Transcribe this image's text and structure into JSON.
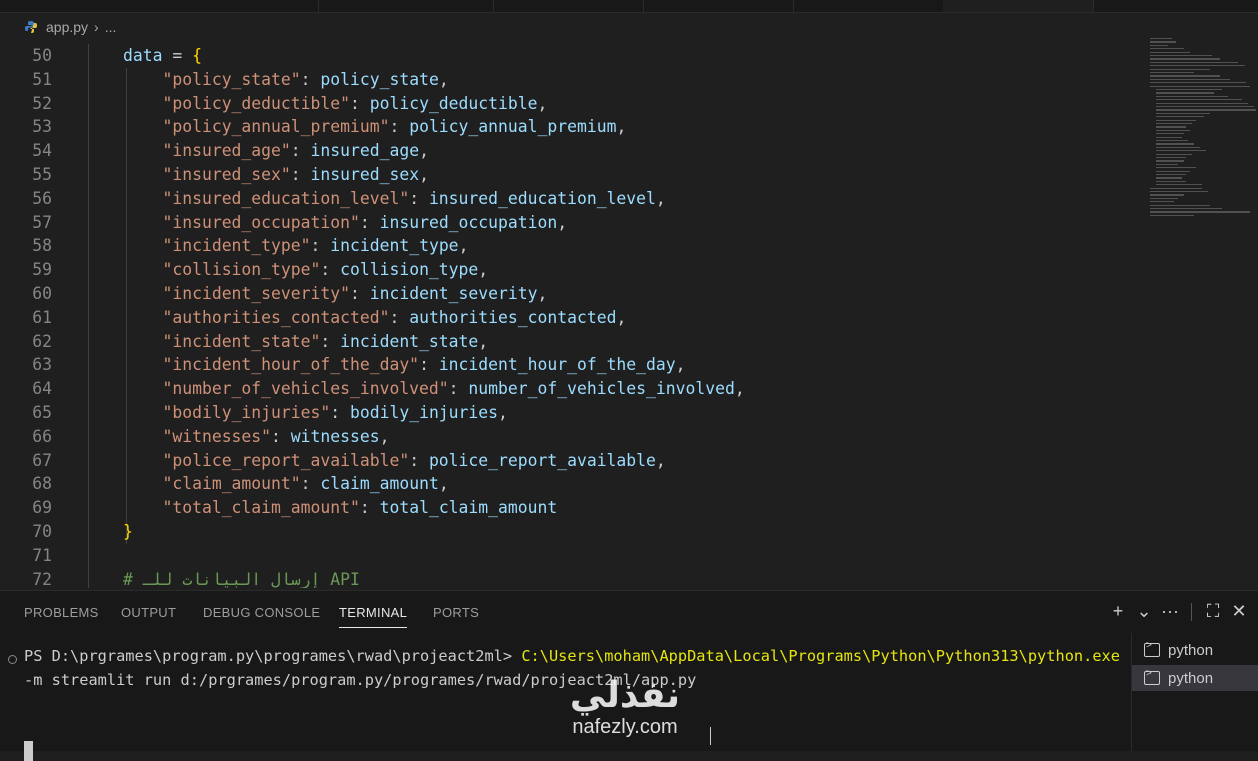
{
  "breadcrumb": {
    "file": "app.py",
    "more": "..."
  },
  "editor": {
    "lines": [
      {
        "num": "50",
        "parts": [
          [
            "v",
            "data"
          ],
          [
            "p",
            " = "
          ],
          [
            "br",
            "{"
          ]
        ]
      },
      {
        "num": "51",
        "parts": [
          [
            "p",
            "    "
          ],
          [
            "k",
            "\"policy_state\""
          ],
          [
            "p",
            ": "
          ],
          [
            "v",
            "policy_state"
          ],
          [
            "p",
            ","
          ]
        ]
      },
      {
        "num": "52",
        "parts": [
          [
            "p",
            "    "
          ],
          [
            "k",
            "\"policy_deductible\""
          ],
          [
            "p",
            ": "
          ],
          [
            "v",
            "policy_deductible"
          ],
          [
            "p",
            ","
          ]
        ]
      },
      {
        "num": "53",
        "parts": [
          [
            "p",
            "    "
          ],
          [
            "k",
            "\"policy_annual_premium\""
          ],
          [
            "p",
            ": "
          ],
          [
            "v",
            "policy_annual_premium"
          ],
          [
            "p",
            ","
          ]
        ]
      },
      {
        "num": "54",
        "parts": [
          [
            "p",
            "    "
          ],
          [
            "k",
            "\"insured_age\""
          ],
          [
            "p",
            ": "
          ],
          [
            "v",
            "insured_age"
          ],
          [
            "p",
            ","
          ]
        ]
      },
      {
        "num": "55",
        "parts": [
          [
            "p",
            "    "
          ],
          [
            "k",
            "\"insured_sex\""
          ],
          [
            "p",
            ": "
          ],
          [
            "v",
            "insured_sex"
          ],
          [
            "p",
            ","
          ]
        ]
      },
      {
        "num": "56",
        "parts": [
          [
            "p",
            "    "
          ],
          [
            "k",
            "\"insured_education_level\""
          ],
          [
            "p",
            ": "
          ],
          [
            "v",
            "insured_education_level"
          ],
          [
            "p",
            ","
          ]
        ]
      },
      {
        "num": "57",
        "parts": [
          [
            "p",
            "    "
          ],
          [
            "k",
            "\"insured_occupation\""
          ],
          [
            "p",
            ": "
          ],
          [
            "v",
            "insured_occupation"
          ],
          [
            "p",
            ","
          ]
        ]
      },
      {
        "num": "58",
        "parts": [
          [
            "p",
            "    "
          ],
          [
            "k",
            "\"incident_type\""
          ],
          [
            "p",
            ": "
          ],
          [
            "v",
            "incident_type"
          ],
          [
            "p",
            ","
          ]
        ]
      },
      {
        "num": "59",
        "parts": [
          [
            "p",
            "    "
          ],
          [
            "k",
            "\"collision_type\""
          ],
          [
            "p",
            ": "
          ],
          [
            "v",
            "collision_type"
          ],
          [
            "p",
            ","
          ]
        ]
      },
      {
        "num": "60",
        "parts": [
          [
            "p",
            "    "
          ],
          [
            "k",
            "\"incident_severity\""
          ],
          [
            "p",
            ": "
          ],
          [
            "v",
            "incident_severity"
          ],
          [
            "p",
            ","
          ]
        ]
      },
      {
        "num": "61",
        "parts": [
          [
            "p",
            "    "
          ],
          [
            "k",
            "\"authorities_contacted\""
          ],
          [
            "p",
            ": "
          ],
          [
            "v",
            "authorities_contacted"
          ],
          [
            "p",
            ","
          ]
        ]
      },
      {
        "num": "62",
        "parts": [
          [
            "p",
            "    "
          ],
          [
            "k",
            "\"incident_state\""
          ],
          [
            "p",
            ": "
          ],
          [
            "v",
            "incident_state"
          ],
          [
            "p",
            ","
          ]
        ]
      },
      {
        "num": "63",
        "parts": [
          [
            "p",
            "    "
          ],
          [
            "k",
            "\"incident_hour_of_the_day\""
          ],
          [
            "p",
            ": "
          ],
          [
            "v",
            "incident_hour_of_the_day"
          ],
          [
            "p",
            ","
          ]
        ]
      },
      {
        "num": "64",
        "parts": [
          [
            "p",
            "    "
          ],
          [
            "k",
            "\"number_of_vehicles_involved\""
          ],
          [
            "p",
            ": "
          ],
          [
            "v",
            "number_of_vehicles_involved"
          ],
          [
            "p",
            ","
          ]
        ]
      },
      {
        "num": "65",
        "parts": [
          [
            "p",
            "    "
          ],
          [
            "k",
            "\"bodily_injuries\""
          ],
          [
            "p",
            ": "
          ],
          [
            "v",
            "bodily_injuries"
          ],
          [
            "p",
            ","
          ]
        ]
      },
      {
        "num": "66",
        "parts": [
          [
            "p",
            "    "
          ],
          [
            "k",
            "\"witnesses\""
          ],
          [
            "p",
            ": "
          ],
          [
            "v",
            "witnesses"
          ],
          [
            "p",
            ","
          ]
        ]
      },
      {
        "num": "67",
        "parts": [
          [
            "p",
            "    "
          ],
          [
            "k",
            "\"police_report_available\""
          ],
          [
            "p",
            ": "
          ],
          [
            "v",
            "police_report_available"
          ],
          [
            "p",
            ","
          ]
        ]
      },
      {
        "num": "68",
        "parts": [
          [
            "p",
            "    "
          ],
          [
            "k",
            "\"claim_amount\""
          ],
          [
            "p",
            ": "
          ],
          [
            "v",
            "claim_amount"
          ],
          [
            "p",
            ","
          ]
        ]
      },
      {
        "num": "69",
        "parts": [
          [
            "p",
            "    "
          ],
          [
            "k",
            "\"total_claim_amount\""
          ],
          [
            "p",
            ": "
          ],
          [
            "v",
            "total_claim_amount"
          ]
        ]
      },
      {
        "num": "70",
        "parts": [
          [
            "br",
            "}"
          ]
        ]
      },
      {
        "num": "71",
        "parts": []
      },
      {
        "num": "72",
        "parts": [
          [
            "cm",
            "# إرسال البيانات للـ API"
          ]
        ]
      }
    ]
  },
  "panel": {
    "tabs": [
      {
        "label": "PROBLEMS",
        "active": false
      },
      {
        "label": "OUTPUT",
        "active": false
      },
      {
        "label": "DEBUG CONSOLE",
        "active": false
      },
      {
        "label": "TERMINAL",
        "active": true
      },
      {
        "label": "PORTS",
        "active": false
      }
    ],
    "actions": {
      "add": "+",
      "dropdown": "⌄",
      "more": "···",
      "maximize": "⛶",
      "close": "✕"
    }
  },
  "terminal": {
    "prompt": "PS D:\\prgrames\\program.py\\programes\\rwad\\projeact2ml> ",
    "exe": "C:\\Users\\moham\\AppData\\Local\\Programs\\Python\\Python313\\python.exe",
    "args": "-m streamlit run d:/prgrames/program.py/programes/rwad/projeact2ml/app.py",
    "instances": [
      {
        "label": "python",
        "selected": false
      },
      {
        "label": "python",
        "selected": true
      }
    ]
  },
  "watermark": {
    "logo": "نفذلي",
    "url": "nafezly.com"
  },
  "colors": {
    "string": "#ce9178",
    "variable": "#9cdcfe",
    "bracket": "#ffd700",
    "exe_path": "#e5e510"
  }
}
